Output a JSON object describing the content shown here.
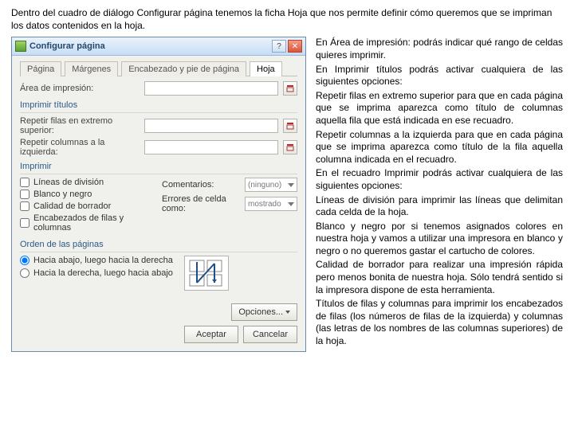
{
  "intro": "Dentro del cuadro de diálogo Configurar página tenemos la ficha Hoja que nos permite definir cómo queremos que se impriman los datos contenidos en la hoja.",
  "dialog": {
    "title": "Configurar página",
    "tabs": {
      "t0": "Página",
      "t1": "Márgenes",
      "t2": "Encabezado y pie de página",
      "t3": "Hoja"
    },
    "group_area": "Área de impresión:",
    "group_titles": "Imprimir títulos",
    "repeat_rows": "Repetir filas en extremo superior:",
    "repeat_cols": "Repetir columnas a la izquierda:",
    "group_print": "Imprimir",
    "chk_grid": "Líneas de división",
    "chk_bw": "Blanco y negro",
    "chk_draft": "Calidad de borrador",
    "chk_headings": "Encabezados de filas y columnas",
    "lbl_comments": "Comentarios:",
    "val_comments": "(ninguno)",
    "lbl_errors": "Errores de celda como:",
    "val_errors": "mostrado",
    "group_order": "Orden de las páginas",
    "radio_down": "Hacia abajo, luego hacia la derecha",
    "radio_across": "Hacia la derecha, luego hacia abajo",
    "btn_options": "Opciones...",
    "btn_ok": "Aceptar",
    "btn_cancel": "Cancelar"
  },
  "right": {
    "p0": "En Área de impresión: podrás indicar qué rango de celdas quieres imprimir.",
    "p1": "En Imprimir títulos podrás activar cualquiera de las siguientes opciones:",
    "p2": "Repetir filas en extremo superior para que en cada página que se imprima aparezca como título de columnas aquella fila que está indicada en ese recuadro.",
    "p3": "Repetir columnas a la izquierda para que en cada página que se imprima aparezca como título de la fila aquella columna indicada en el recuadro.",
    "p4": "En el recuadro Imprimir podrás activar cualquiera de las siguientes opciones:",
    "p5": "Líneas de división para imprimir las líneas que delimitan cada celda de la hoja.",
    "p6": "Blanco y negro por si tenemos asignados colores en nuestra hoja y vamos a utilizar una impresora en blanco y negro o no queremos gastar el cartucho de colores.",
    "p7": "Calidad de borrador para realizar una impresión rápida pero menos bonita de nuestra hoja. Sólo tendrá sentido si la impresora dispone de esta herramienta.",
    "p8": "Títulos de filas y columnas para imprimir los encabezados de filas (los números de filas de la izquierda) y columnas (las letras de los nombres de las columnas superiores) de la hoja."
  }
}
